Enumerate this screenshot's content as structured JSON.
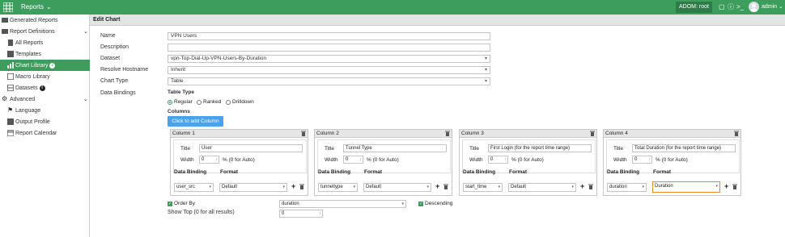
{
  "topbar": {
    "app_label": "Reports",
    "adom_label": "ADOM: root",
    "user_label": "admin",
    "brand_color": "#3c9d5d"
  },
  "sidebar": {
    "items": [
      {
        "label": "Generated Reports",
        "icon": "folder-icon"
      },
      {
        "label": "Report Definitions",
        "icon": "folder-icon"
      },
      {
        "label": "All Reports",
        "icon": "report-icon"
      },
      {
        "label": "Templates",
        "icon": "template-icon"
      },
      {
        "label": "Chart Library",
        "icon": "chart-icon"
      },
      {
        "label": "Macro Library",
        "icon": "macro-icon"
      },
      {
        "label": "Datasets",
        "icon": "dataset-icon"
      },
      {
        "label": "Advanced",
        "icon": "gear-icon"
      },
      {
        "label": "Language",
        "icon": "flag-icon"
      },
      {
        "label": "Output Profile",
        "icon": "output-icon"
      },
      {
        "label": "Report Calendar",
        "icon": "calendar-icon"
      }
    ]
  },
  "page": {
    "title": "Edit Chart"
  },
  "form": {
    "name_label": "Name",
    "name_value": "VPN Users",
    "description_label": "Description",
    "description_value": "",
    "dataset_label": "Dataset",
    "dataset_value": "vpn-Top-Dial-Up-VPN-Users-By-Duration",
    "resolve_label": "Resolve Hostname",
    "resolve_value": "Inherit",
    "chart_type_label": "Chart Type",
    "chart_type_value": "Table",
    "data_bindings_label": "Data Bindings",
    "table_type_label": "Table Type",
    "table_types": [
      "Regular",
      "Ranked",
      "Drilldown"
    ],
    "table_type_selected": "Regular",
    "columns_label": "Columns",
    "add_column_label": "Click to add Column"
  },
  "columns": [
    {
      "header": "Column 1",
      "title_label": "Title",
      "title": "User",
      "width_label": "Width",
      "width": "0",
      "width_hint": "% (0 for Auto)",
      "binding_label": "Data Binding",
      "format_label": "Format",
      "binding": "user_src",
      "format": "Default"
    },
    {
      "header": "Column 2",
      "title_label": "Title",
      "title": "Tunnel Type",
      "width_label": "Width",
      "width": "0",
      "width_hint": "% (0 for Auto)",
      "binding_label": "Data Binding",
      "format_label": "Format",
      "binding": "tunneltype",
      "format": "Default"
    },
    {
      "header": "Column 3",
      "title_label": "Title",
      "title": "First Login (for the report time range)",
      "width_label": "Width",
      "width": "0",
      "width_hint": "% (0 for Auto)",
      "binding_label": "Data Binding",
      "format_label": "Format",
      "binding": "start_time",
      "format": "Default"
    },
    {
      "header": "Column 4",
      "title_label": "Title",
      "title": "Total Duration (for the report time range)",
      "width_label": "Width",
      "width": "0",
      "width_hint": "% (0 for Auto)",
      "binding_label": "Data Binding",
      "format_label": "Format",
      "binding": "duration",
      "format": "Duration"
    }
  ],
  "order": {
    "order_by_label": "Order By",
    "order_by_value": "duration",
    "descending_label": "Descending",
    "show_top_label": "Show Top (0 for all results)",
    "show_top_value": "0"
  }
}
